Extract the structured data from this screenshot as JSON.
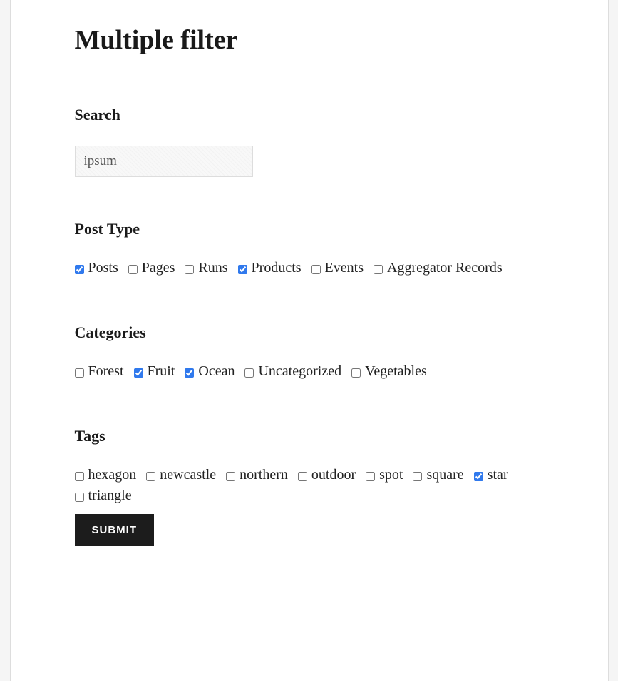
{
  "title": "Multiple filter",
  "search": {
    "heading": "Search",
    "value": "ipsum"
  },
  "postType": {
    "heading": "Post Type",
    "items": [
      {
        "label": "Posts",
        "checked": true
      },
      {
        "label": "Pages",
        "checked": false
      },
      {
        "label": "Runs",
        "checked": false
      },
      {
        "label": "Products",
        "checked": true
      },
      {
        "label": "Events",
        "checked": false
      },
      {
        "label": "Aggregator Records",
        "checked": false
      }
    ]
  },
  "categories": {
    "heading": "Categories",
    "items": [
      {
        "label": "Forest",
        "checked": false
      },
      {
        "label": "Fruit",
        "checked": true
      },
      {
        "label": "Ocean",
        "checked": true
      },
      {
        "label": "Uncategorized",
        "checked": false
      },
      {
        "label": "Vegetables",
        "checked": false
      }
    ]
  },
  "tags": {
    "heading": "Tags",
    "items": [
      {
        "label": "hexagon",
        "checked": false
      },
      {
        "label": "newcastle",
        "checked": false
      },
      {
        "label": "northern",
        "checked": false
      },
      {
        "label": "outdoor",
        "checked": false
      },
      {
        "label": "spot",
        "checked": false
      },
      {
        "label": "square",
        "checked": false
      },
      {
        "label": "star",
        "checked": true
      },
      {
        "label": "triangle",
        "checked": false
      }
    ]
  },
  "submitLabel": "Submit"
}
